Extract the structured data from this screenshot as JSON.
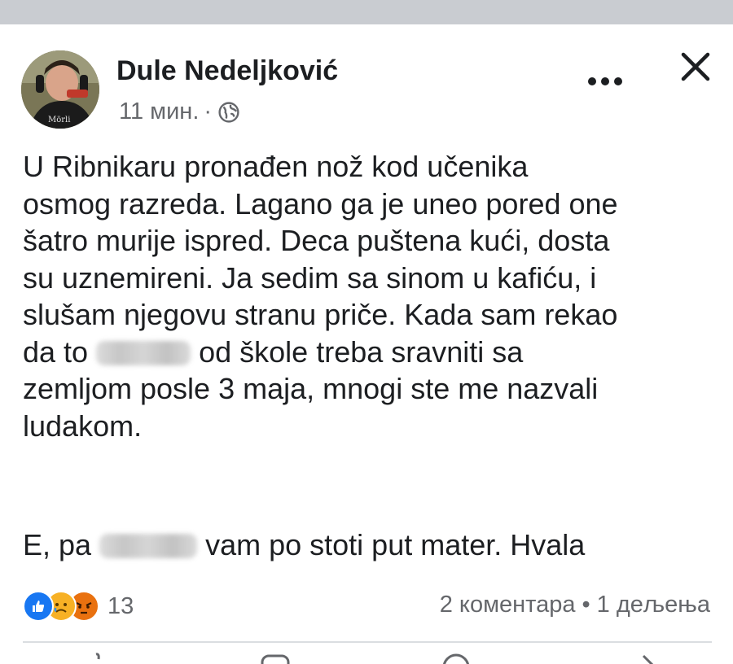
{
  "post": {
    "author_name": "Dule Nedeljković",
    "time": "11 мин.",
    "time_separator": "·",
    "privacy_icon": "globe-icon",
    "body_lines": [
      "U Ribnikaru pronađen nož kod učenika",
      "osmog razreda. Lagano ga je uneo pored one",
      "šatro murije ispred. Deca puštena kući, dosta",
      "su uznemireni. Ja sedim sa sinom u kafiću, i",
      "slušam njegovu stranu priče. Kada sam rekao"
    ],
    "line6_before": "da to",
    "line6_after": "od škole treba sravniti sa",
    "body_lines_end": [
      "zemljom posle 3 maja, mnogi ste me nazvali",
      "ludakom."
    ],
    "closing_before": "E, pa",
    "closing_after": "vam po stoti put mater. Hvala"
  },
  "reactions": {
    "icons": [
      "like-icon",
      "sad-icon",
      "angry-icon"
    ],
    "count": "13"
  },
  "stats": {
    "comments": "2 коментара",
    "separator": "•",
    "shares": "1 дељења"
  },
  "colors": {
    "like": "#1877f2",
    "sad": "#f7b125",
    "angry": "#e9710f",
    "secondary_text": "#65676b",
    "top_strip": "#c9ccd1"
  }
}
